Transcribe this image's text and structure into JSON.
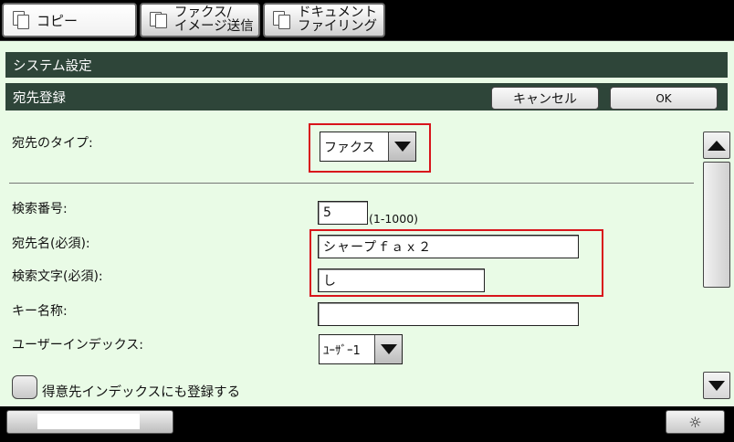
{
  "tabs": [
    {
      "label": "コピー"
    },
    {
      "label_line1": "ファクス/",
      "label_line2": "イメージ送信"
    },
    {
      "label_line1": "ドキュメント",
      "label_line2": "ファイリング"
    }
  ],
  "header": {
    "system_title": "システム設定",
    "section_title": "宛先登録",
    "cancel_label": "キャンセル",
    "ok_label": "OK"
  },
  "form": {
    "dest_type_label": "宛先のタイプ:",
    "dest_type_value": "ファクス",
    "search_no_label": "検索番号:",
    "search_no_value": "5",
    "search_no_range": "(1-1000)",
    "dest_name_label": "宛先名(必須):",
    "dest_name_value": "シャープｆａｘ２",
    "search_char_label": "検索文字(必須):",
    "search_char_value": "し",
    "key_name_label": "キー名称:",
    "key_name_value": "",
    "user_index_label": "ユーザーインデックス:",
    "user_index_value": "ﾕｰｻﾞｰ1",
    "register_favorite_label": "得意先インデックスにも登録する"
  },
  "footer": {
    "brightness_icon": "sun-icon"
  },
  "colors": {
    "bar": "#2e4539",
    "panel": "#e9fbe6",
    "highlight": "#d8141b"
  }
}
